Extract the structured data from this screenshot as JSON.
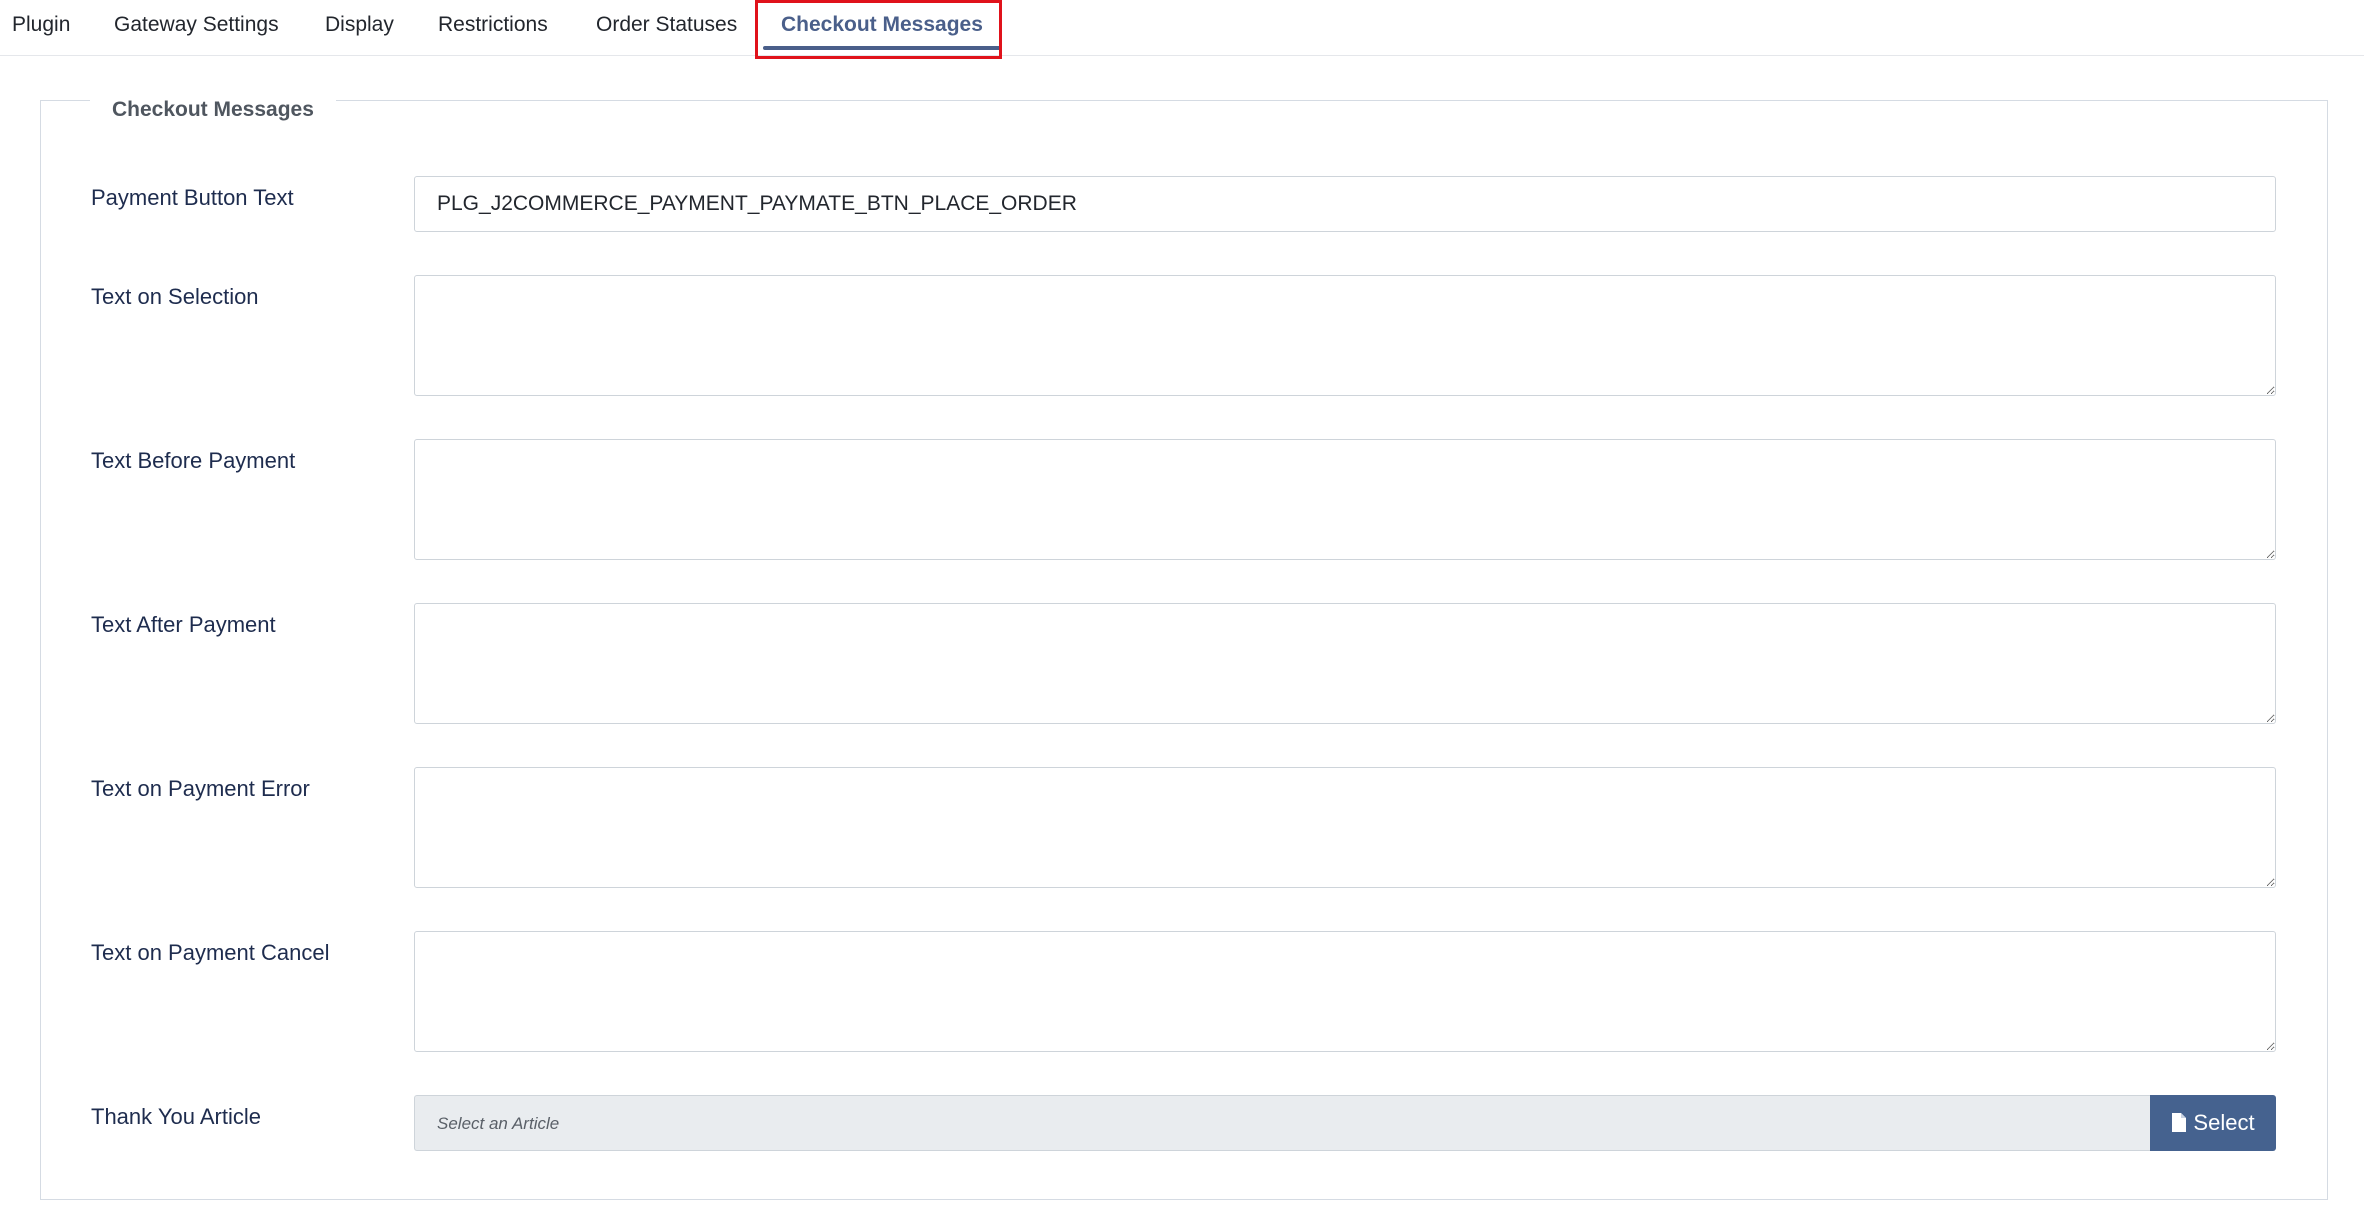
{
  "tabs": [
    {
      "label": "Plugin"
    },
    {
      "label": "Gateway Settings"
    },
    {
      "label": "Display"
    },
    {
      "label": "Restrictions"
    },
    {
      "label": "Order Statuses"
    },
    {
      "label": "Checkout Messages",
      "active": true
    }
  ],
  "fieldset": {
    "legend": "Checkout Messages"
  },
  "fields": {
    "payment_button_text": {
      "label": "Payment Button Text",
      "value": "PLG_J2COMMERCE_PAYMENT_PAYMATE_BTN_PLACE_ORDER"
    },
    "text_on_selection": {
      "label": "Text on Selection",
      "value": ""
    },
    "text_before_payment": {
      "label": "Text Before Payment",
      "value": ""
    },
    "text_after_payment": {
      "label": "Text After Payment",
      "value": ""
    },
    "text_on_payment_error": {
      "label": "Text on Payment Error",
      "value": ""
    },
    "text_on_payment_cancel": {
      "label": "Text on Payment Cancel",
      "value": ""
    },
    "thank_you_article": {
      "label": "Thank You Article",
      "placeholder": "Select an Article",
      "button_label": "Select",
      "button_icon": "file-icon"
    }
  },
  "colors": {
    "accent": "#4a5f8a",
    "button_bg": "#45628f",
    "highlight_border": "#e0121b"
  }
}
